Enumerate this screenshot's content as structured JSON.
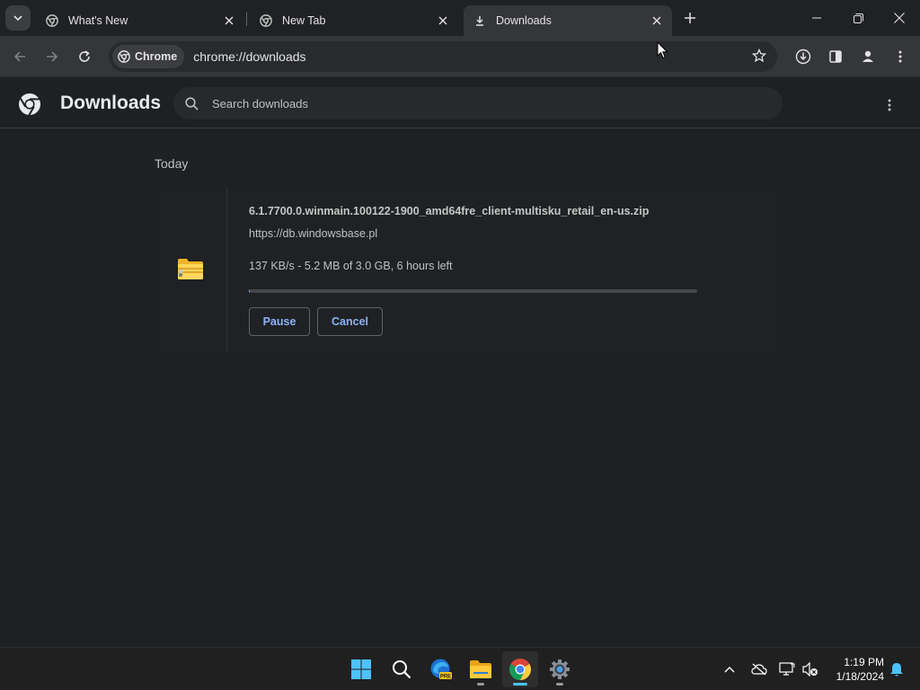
{
  "tabs": [
    {
      "title": "What's New",
      "icon": "chrome-icon"
    },
    {
      "title": "New Tab",
      "icon": "chrome-icon"
    },
    {
      "title": "Downloads",
      "icon": "download-icon",
      "active": true
    }
  ],
  "omnibox": {
    "chip_label": "Chrome",
    "url": "chrome://downloads"
  },
  "downloads_page": {
    "title": "Downloads",
    "search_placeholder": "Search downloads",
    "date_group": "Today",
    "item": {
      "filename": "6.1.7700.0.winmain.100122-1900_amd64fre_client-multisku_retail_en-us.zip",
      "source_url": "https://db.windowsbase.pl",
      "status": "137 KB/s - 5.2 MB of 3.0 GB, 6 hours left",
      "progress_fraction": 0.0017,
      "pause_label": "Pause",
      "cancel_label": "Cancel"
    }
  },
  "taskbar": {
    "apps": [
      "windows-start-icon",
      "search-icon",
      "edge-beta-icon",
      "file-explorer-icon",
      "chrome-icon",
      "settings-icon"
    ],
    "edge_badge": "PRE",
    "time": "1:19 PM",
    "date": "1/18/2024"
  },
  "colors": {
    "accent": "#8ab4f8",
    "progress": "#7cacf8",
    "background": "#1f2023"
  }
}
